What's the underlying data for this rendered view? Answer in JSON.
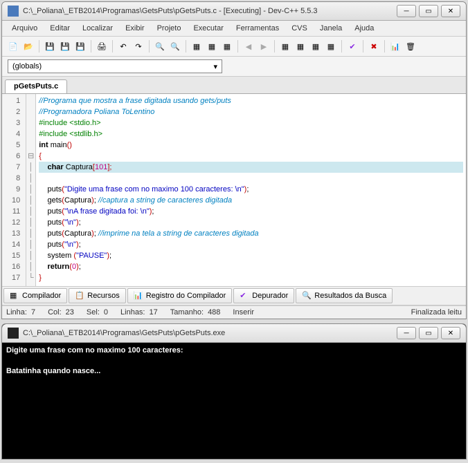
{
  "window": {
    "title": "C:\\_Poliana\\_ETB2014\\Programas\\GetsPuts\\pGetsPuts.c - [Executing] - Dev-C++ 5.5.3"
  },
  "menu": {
    "arquivo": "Arquivo",
    "editar": "Editar",
    "localizar": "Localizar",
    "exibir": "Exibir",
    "projeto": "Projeto",
    "executar": "Executar",
    "ferramentas": "Ferramentas",
    "cvs": "CVS",
    "janela": "Janela",
    "ajuda": "Ajuda"
  },
  "combo": {
    "value": "(globals)"
  },
  "tab": {
    "name": "pGetsPuts.c"
  },
  "code": {
    "l1": "//Programa que mostra a frase digitada usando gets/puts",
    "l2": "//Programadora Poliana ToLentino",
    "l3a": "#include",
    "l3b": " <stdio.h>",
    "l4a": "#include",
    "l4b": " <stdlib.h>",
    "l5a": "int",
    "l5b": " main",
    "l5c": "()",
    "l6": "{",
    "l7a": "    char",
    "l7b": " Captura",
    "l7c": "[",
    "l7d": "101",
    "l7e": "];",
    "l9a": "    puts",
    "l9p1": "(",
    "l9s": "\"Digite uma frase com no maximo 100 caracteres: \\n\"",
    "l9p2": ")",
    "l9e": ";",
    "l10a": "    gets",
    "l10p1": "(",
    "l10b": "Captura",
    "l10p2": ")",
    "l10e": "; ",
    "l10c": "//captura a string de caracteres digitada",
    "l11a": "    puts",
    "l11p1": "(",
    "l11s": "\"\\nA frase digitada foi: \\n\"",
    "l11p2": ")",
    "l11e": ";",
    "l12a": "    puts",
    "l12p1": "(",
    "l12s": "\"\\n\"",
    "l12p2": ")",
    "l12e": ";",
    "l13a": "    puts",
    "l13p1": "(",
    "l13b": "Captura",
    "l13p2": ")",
    "l13e": "; ",
    "l13c": "//imprime na tela a string de caracteres digitada",
    "l14a": "    puts",
    "l14p1": "(",
    "l14s": "\"\\n\"",
    "l14p2": ")",
    "l14e": ";",
    "l15a": "    system ",
    "l15p1": "(",
    "l15s": "\"PAUSE\"",
    "l15p2": ")",
    "l15e": ";",
    "l16a": "    return",
    "l16p1": "(",
    "l16n": "0",
    "l16p2": ")",
    "l16e": ";",
    "l17": "}"
  },
  "gutter": [
    "1",
    "2",
    "3",
    "4",
    "5",
    "6",
    "7",
    "8",
    "9",
    "10",
    "11",
    "12",
    "13",
    "14",
    "15",
    "16",
    "17"
  ],
  "btabs": {
    "compilador": "Compilador",
    "recursos": "Recursos",
    "registro": "Registro do Compilador",
    "depurador": "Depurador",
    "busca": "Resultados da Busca"
  },
  "status": {
    "linha_lbl": "Linha:",
    "linha_val": "7",
    "col_lbl": "Col:",
    "col_val": "23",
    "sel_lbl": "Sel:",
    "sel_val": "0",
    "linhas_lbl": "Linhas:",
    "linhas_val": "17",
    "tam_lbl": "Tamanho:",
    "tam_val": "488",
    "inserir": "Inserir",
    "final": "Finalizada leitu"
  },
  "console": {
    "title": "C:\\_Poliana\\_ETB2014\\Programas\\GetsPuts\\pGetsPuts.exe",
    "line1": "Digite uma frase com no maximo 100 caracteres:",
    "line2": "",
    "line3": "Batatinha quando nasce..."
  }
}
